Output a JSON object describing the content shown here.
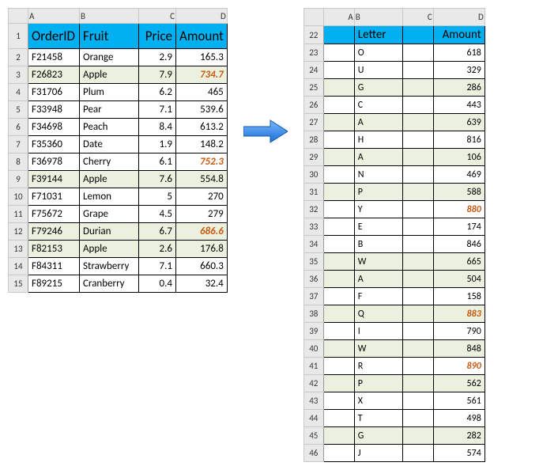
{
  "left": {
    "columns": [
      "A",
      "B",
      "C",
      "D"
    ],
    "headers": {
      "a": "OrderID",
      "b": "Fruit",
      "c": "Price",
      "d": "Amount"
    },
    "rows": [
      {
        "n": 2,
        "a": "F21458",
        "b": "Orange",
        "c": "2.9",
        "d": "165.3"
      },
      {
        "n": 3,
        "a": "F26823",
        "b": "Apple",
        "c": "7.9",
        "d": "734.7",
        "hl": true,
        "em": true
      },
      {
        "n": 4,
        "a": "F31706",
        "b": "Plum",
        "c": "6.2",
        "d": "465"
      },
      {
        "n": 5,
        "a": "F33948",
        "b": "Pear",
        "c": "7.1",
        "d": "539.6"
      },
      {
        "n": 6,
        "a": "F34698",
        "b": "Peach",
        "c": "8.4",
        "d": "613.2"
      },
      {
        "n": 7,
        "a": "F35360",
        "b": "Date",
        "c": "1.9",
        "d": "148.2"
      },
      {
        "n": 8,
        "a": "F36978",
        "b": "Cherry",
        "c": "6.1",
        "d": "752.3",
        "em": true
      },
      {
        "n": 9,
        "a": "F39144",
        "b": "Apple",
        "c": "7.6",
        "d": "554.8",
        "hl": true
      },
      {
        "n": 10,
        "a": "F71031",
        "b": "Lemon",
        "c": "5",
        "d": "270"
      },
      {
        "n": 11,
        "a": "F75672",
        "b": "Grape",
        "c": "4.5",
        "d": "279"
      },
      {
        "n": 12,
        "a": "F79246",
        "b": "Durian",
        "c": "6.7",
        "d": "686.6",
        "hl": true,
        "em": true
      },
      {
        "n": 13,
        "a": "F82153",
        "b": "Apple",
        "c": "2.6",
        "d": "176.8",
        "hl": true
      },
      {
        "n": 14,
        "a": "F84311",
        "b": "Strawberry",
        "c": "7.1",
        "d": "660.3"
      },
      {
        "n": 15,
        "a": "F89215",
        "b": "Cranberry",
        "c": "0.4",
        "d": "32.4"
      }
    ]
  },
  "right": {
    "columns": [
      "A",
      "B",
      "C",
      "D"
    ],
    "headers": {
      "a": "",
      "b": "Letter",
      "c": "",
      "d": "Amount"
    },
    "headerRowNum": 22,
    "rows": [
      {
        "n": 23,
        "b": "O",
        "d": "618"
      },
      {
        "n": 24,
        "b": "U",
        "d": "329"
      },
      {
        "n": 25,
        "b": "G",
        "d": "286",
        "hl": true
      },
      {
        "n": 26,
        "b": "C",
        "d": "443"
      },
      {
        "n": 27,
        "b": "A",
        "d": "639",
        "hl": true
      },
      {
        "n": 28,
        "b": "H",
        "d": "816"
      },
      {
        "n": 29,
        "b": "A",
        "d": "106",
        "hl": true
      },
      {
        "n": 30,
        "b": "N",
        "d": "469"
      },
      {
        "n": 31,
        "b": "P",
        "d": "588",
        "hl": true
      },
      {
        "n": 32,
        "b": "Y",
        "d": "880",
        "em": true
      },
      {
        "n": 33,
        "b": "E",
        "d": "174"
      },
      {
        "n": 34,
        "b": "B",
        "d": "846"
      },
      {
        "n": 35,
        "b": "W",
        "d": "665",
        "hl": true
      },
      {
        "n": 36,
        "b": "A",
        "d": "504",
        "hl": true
      },
      {
        "n": 37,
        "b": "F",
        "d": "158"
      },
      {
        "n": 38,
        "b": "Q",
        "d": "883",
        "em": true,
        "hl": true
      },
      {
        "n": 39,
        "b": "I",
        "d": "790"
      },
      {
        "n": 40,
        "b": "W",
        "d": "848",
        "hl": true
      },
      {
        "n": 41,
        "b": "R",
        "d": "890",
        "em": true
      },
      {
        "n": 42,
        "b": "P",
        "d": "562",
        "hl": true
      },
      {
        "n": 43,
        "b": "X",
        "d": "561"
      },
      {
        "n": 44,
        "b": "T",
        "d": "498"
      },
      {
        "n": 45,
        "b": "G",
        "d": "282",
        "hl": true
      },
      {
        "n": 46,
        "b": "J",
        "d": "574"
      }
    ]
  }
}
